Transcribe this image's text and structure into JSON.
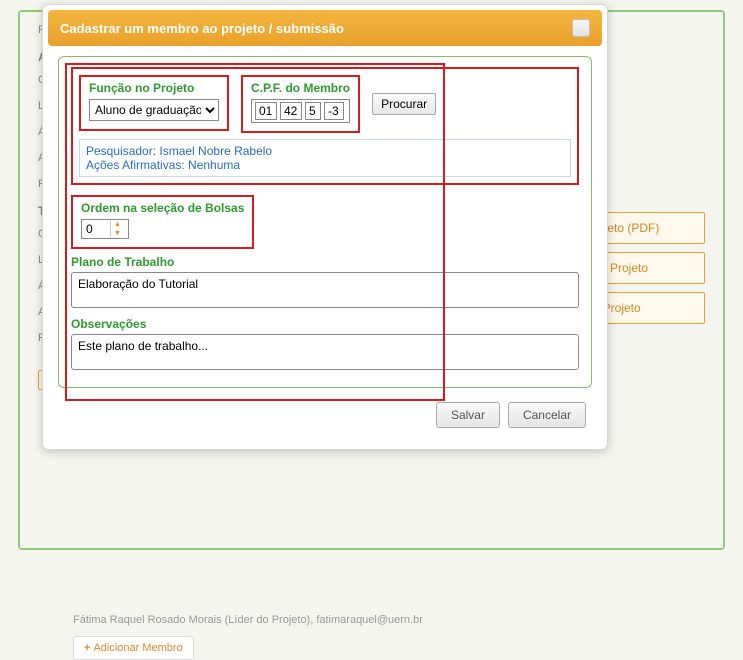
{
  "background": {
    "labels": [
      "Pa",
      "Av",
      "Gr",
      "Lir",
      "Áre",
      "Arc",
      "Pa",
      "Tu",
      "Gr",
      "Lir",
      "Áre",
      "Arc",
      "Pa"
    ],
    "right_buttons": {
      "pdf": "Projeto (PDF)",
      "submit": "eter Projeto",
      "delete": "uir Projeto"
    },
    "member_line": "Fátima Raquel Rosado Morais (Líder do Projeto), fatimaraquel@uern.br",
    "add_member": "Adicionar Membro"
  },
  "modal": {
    "title": "Cadastrar um membro ao projeto / submissão",
    "funcao": {
      "label": "Função no Projeto",
      "value": "Aluno de graduação"
    },
    "cpf": {
      "label": "C.P.F. do Membro",
      "p1": "01",
      "p2": "42",
      "p3": "5",
      "p4": "-3"
    },
    "procurar_label": "Procurar",
    "info": {
      "line1": "Pesquisador: Ismael Nobre Rabelo",
      "line2": "Ações Afirmativas: Nenhuma"
    },
    "ordem": {
      "label": "Ordem na seleção de Bolsas",
      "value": "0"
    },
    "plano": {
      "label": "Plano de Trabalho",
      "value": "Elaboração do Tutorial"
    },
    "obs": {
      "label": "Observações",
      "value": "Este plano de trabalho..."
    },
    "save_label": "Salvar",
    "cancel_label": "Cancelar"
  }
}
